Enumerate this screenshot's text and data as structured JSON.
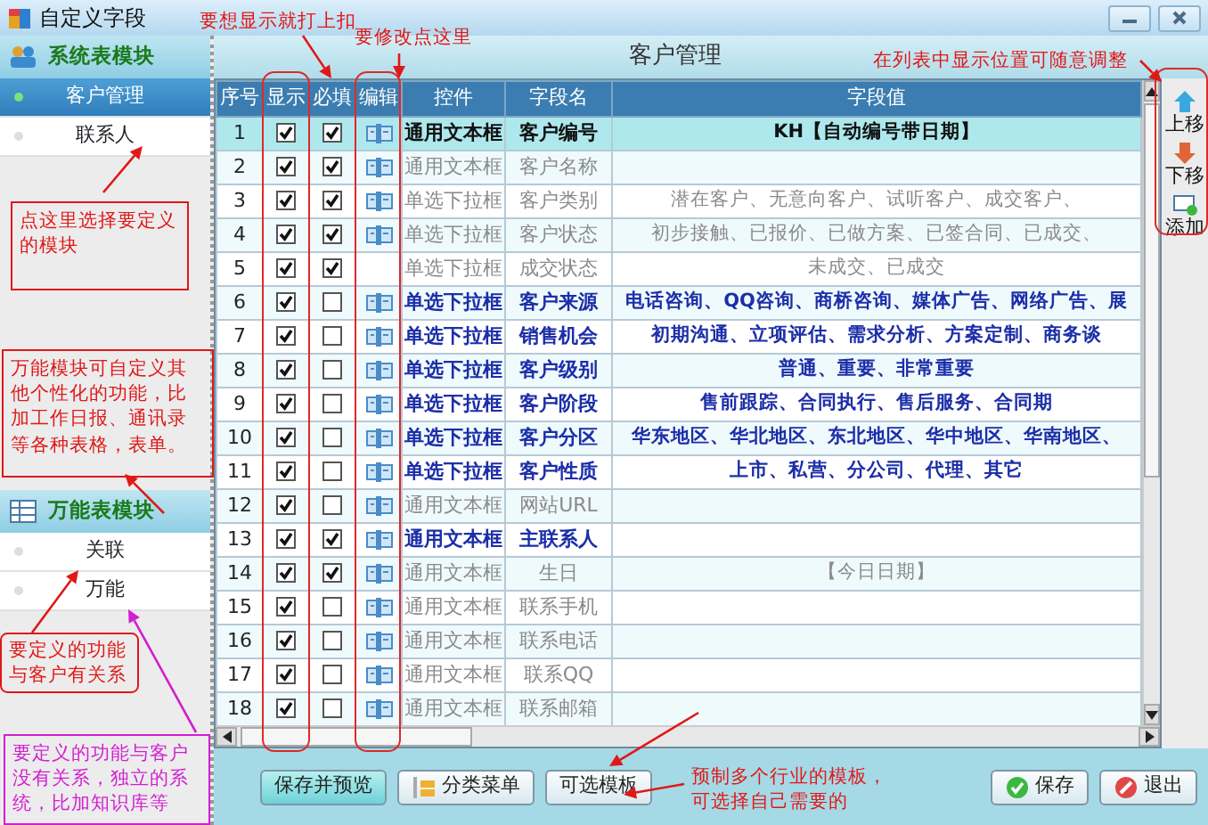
{
  "window": {
    "title": "自定义字段"
  },
  "sidebar": {
    "sections": [
      {
        "title": "系统表模块",
        "kind": "system",
        "items": [
          {
            "label": "客户管理",
            "selected": true
          },
          {
            "label": "联系人",
            "selected": false
          }
        ]
      },
      {
        "title": "万能表模块",
        "kind": "universal",
        "items": [
          {
            "label": "关联",
            "selected": false
          },
          {
            "label": "万能",
            "selected": false
          }
        ]
      }
    ]
  },
  "panel_title": "客户管理",
  "table": {
    "columns": [
      "序号",
      "显示",
      "必填",
      "编辑",
      "控件",
      "字段名",
      "字段值"
    ],
    "rows": [
      {
        "index": "1",
        "visible": true,
        "required": true,
        "editable": true,
        "control": "通用文本框",
        "field": "客户编号",
        "value": "KH【自动编号带日期】",
        "emphasized": true,
        "selected": true
      },
      {
        "index": "2",
        "visible": true,
        "required": true,
        "editable": true,
        "control": "通用文本框",
        "field": "客户名称",
        "emphasized": false,
        "selected": false
      },
      {
        "index": "3",
        "visible": true,
        "required": true,
        "editable": true,
        "control": "单选下拉框",
        "field": "客户类别",
        "value": "潜在客户、无意向客户、试听客户、成交客户、",
        "emphasized": false,
        "selected": false
      },
      {
        "index": "4",
        "visible": true,
        "required": true,
        "editable": true,
        "control": "单选下拉框",
        "field": "客户状态",
        "value": "初步接触、已报价、已做方案、已签合同、已成交、",
        "emphasized": false,
        "selected": false
      },
      {
        "index": "5",
        "visible": true,
        "required": true,
        "editable": false,
        "control": "单选下拉框",
        "field": "成交状态",
        "value": "未成交、已成交",
        "emphasized": false,
        "selected": false
      },
      {
        "index": "6",
        "visible": true,
        "required": false,
        "editable": true,
        "control": "单选下拉框",
        "field": "客户来源",
        "value": "电话咨询、QQ咨询、商桥咨询、媒体广告、网络广告、展",
        "emphasized": true,
        "selected": false
      },
      {
        "index": "7",
        "visible": true,
        "required": false,
        "editable": true,
        "control": "单选下拉框",
        "field": "销售机会",
        "value": "初期沟通、立项评估、需求分析、方案定制、商务谈",
        "emphasized": true,
        "selected": false
      },
      {
        "index": "8",
        "visible": true,
        "required": false,
        "editable": true,
        "control": "单选下拉框",
        "field": "客户级别",
        "value": "普通、重要、非常重要",
        "emphasized": true,
        "selected": false
      },
      {
        "index": "9",
        "visible": true,
        "required": false,
        "editable": true,
        "control": "单选下拉框",
        "field": "客户阶段",
        "value": "售前跟踪、合同执行、售后服务、合同期",
        "emphasized": true,
        "selected": false
      },
      {
        "index": "10",
        "visible": true,
        "required": false,
        "editable": true,
        "control": "单选下拉框",
        "field": "客户分区",
        "value": "华东地区、华北地区、东北地区、华中地区、华南地区、",
        "emphasized": true,
        "selected": false
      },
      {
        "index": "11",
        "visible": true,
        "required": false,
        "editable": true,
        "control": "单选下拉框",
        "field": "客户性质",
        "value": "上市、私营、分公司、代理、其它",
        "emphasized": true,
        "selected": false
      },
      {
        "index": "12",
        "visible": true,
        "required": false,
        "editable": true,
        "control": "通用文本框",
        "field": "网站URL",
        "emphasized": false,
        "selected": false
      },
      {
        "index": "13",
        "visible": true,
        "required": true,
        "editable": true,
        "control": "通用文本框",
        "field": "主联系人",
        "emphasized": true,
        "selected": false
      },
      {
        "index": "14",
        "visible": true,
        "required": true,
        "editable": true,
        "control": "通用文本框",
        "field": "生日",
        "value": "【今日日期】",
        "emphasized": false,
        "selected": false
      },
      {
        "index": "15",
        "visible": true,
        "required": false,
        "editable": true,
        "control": "通用文本框",
        "field": "联系手机",
        "emphasized": false,
        "selected": false
      },
      {
        "index": "16",
        "visible": true,
        "required": false,
        "editable": true,
        "control": "通用文本框",
        "field": "联系电话",
        "emphasized": false,
        "selected": false
      },
      {
        "index": "17",
        "visible": true,
        "required": false,
        "editable": true,
        "control": "通用文本框",
        "field": "联系QQ",
        "emphasized": false,
        "selected": false
      },
      {
        "index": "18",
        "visible": true,
        "required": false,
        "editable": true,
        "control": "通用文本框",
        "field": "联系邮箱",
        "emphasized": false,
        "selected": false
      }
    ]
  },
  "side_tools": [
    {
      "label": "上移",
      "kind": "up"
    },
    {
      "label": "下移",
      "kind": "down"
    },
    {
      "label": "添加",
      "kind": "add"
    }
  ],
  "buttons": [
    {
      "label": "保存并预览",
      "kind": "preview"
    },
    {
      "label": "分类菜单",
      "kind": "menu"
    },
    {
      "label": "可选模板",
      "kind": "plain"
    },
    {
      "label": "保存",
      "kind": "save"
    },
    {
      "label": "退出",
      "kind": "exit"
    }
  ],
  "annotations": [
    {
      "text": "要想显示就打上扣",
      "kind": "plain",
      "color": "#e01818"
    },
    {
      "text": "要修改点这里",
      "kind": "plain",
      "color": "#e01818"
    },
    {
      "text": "在列表中显示位置可随意调整",
      "kind": "plain",
      "color": "#e01818"
    },
    {
      "text": "点这里选择要定义的模块",
      "kind": "box",
      "color": "#e01818"
    },
    {
      "text": "万能模块可自定义其他个性化的功能，比加工作日报、通讯录等各种表格，表单。",
      "kind": "box",
      "color": "#e01818"
    },
    {
      "text": "要定义的功能与客户有关系",
      "kind": "rounded",
      "color": "#e01818"
    },
    {
      "text": "要定义的功能与客户没有关系，独立的系统，比加知识库等",
      "kind": "box",
      "color": "#d21ed2"
    },
    {
      "text": "预制多个行业的模板，可选择自己需要的",
      "kind": "plain",
      "color": "#e01818"
    }
  ]
}
